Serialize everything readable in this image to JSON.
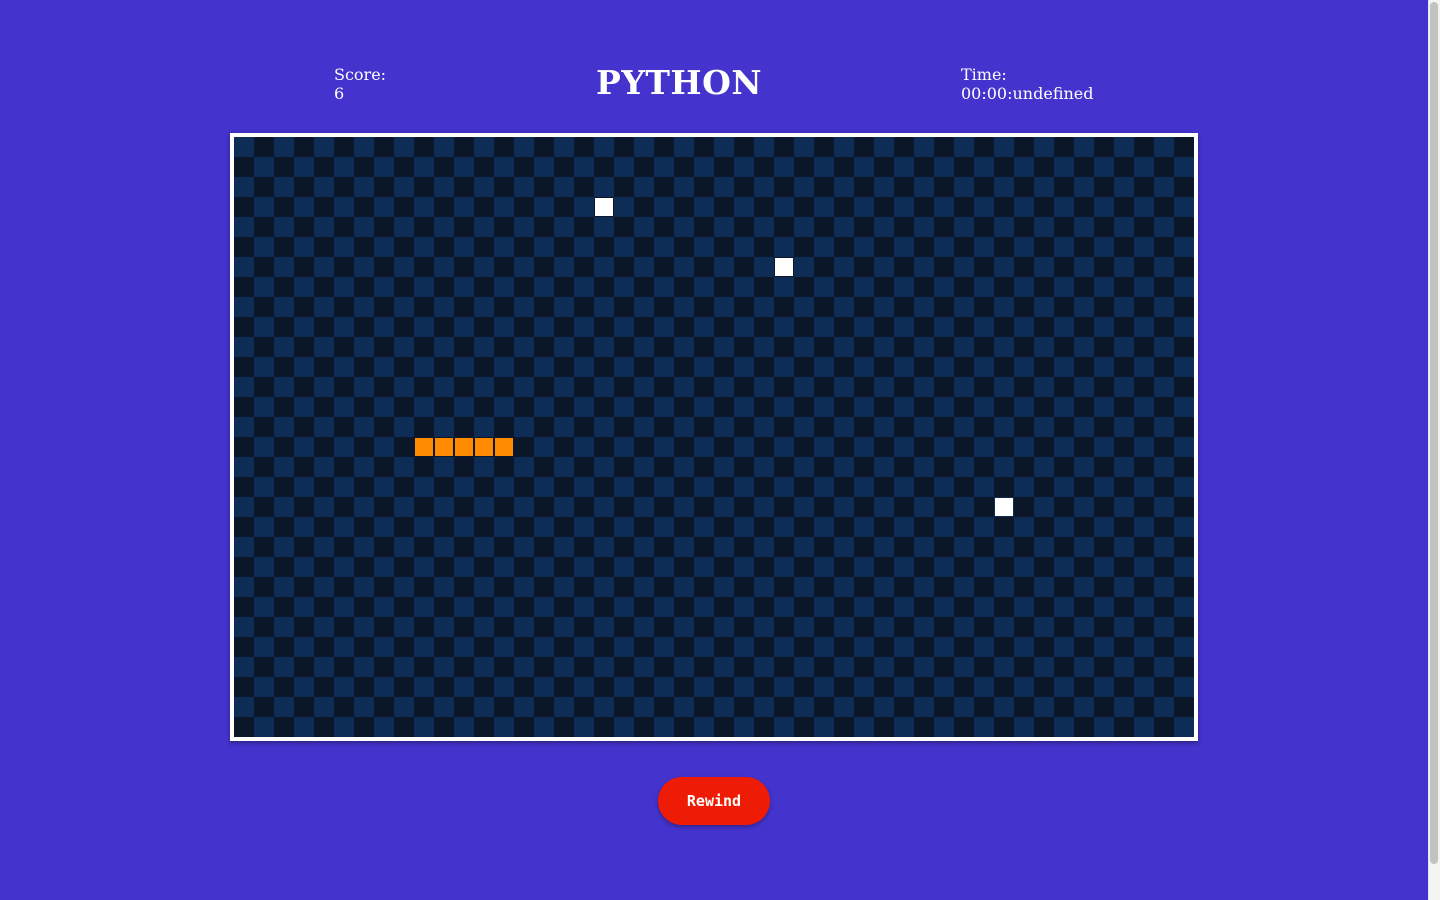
{
  "header": {
    "score_label": "Score:",
    "score_value": "6",
    "title": "PYTHON",
    "time_label": "Time:",
    "time_value": "00:00:undefined"
  },
  "board": {
    "columns": 48,
    "rows": 30,
    "colors": {
      "dark_tile": "#0b1628",
      "light_tile": "#0d2d57",
      "frame": "#ffffff",
      "snake": "#ff8c00",
      "food": "#ffffff"
    },
    "snake": [
      {
        "col": 9,
        "row": 15
      },
      {
        "col": 10,
        "row": 15
      },
      {
        "col": 11,
        "row": 15
      },
      {
        "col": 12,
        "row": 15
      },
      {
        "col": 13,
        "row": 15
      }
    ],
    "food": [
      {
        "col": 18,
        "row": 3
      },
      {
        "col": 27,
        "row": 6
      },
      {
        "col": 38,
        "row": 18
      }
    ]
  },
  "controls": {
    "rewind_label": "Rewind",
    "rewind_color": "#ee1c05"
  },
  "page": {
    "background": "#4433cc"
  }
}
